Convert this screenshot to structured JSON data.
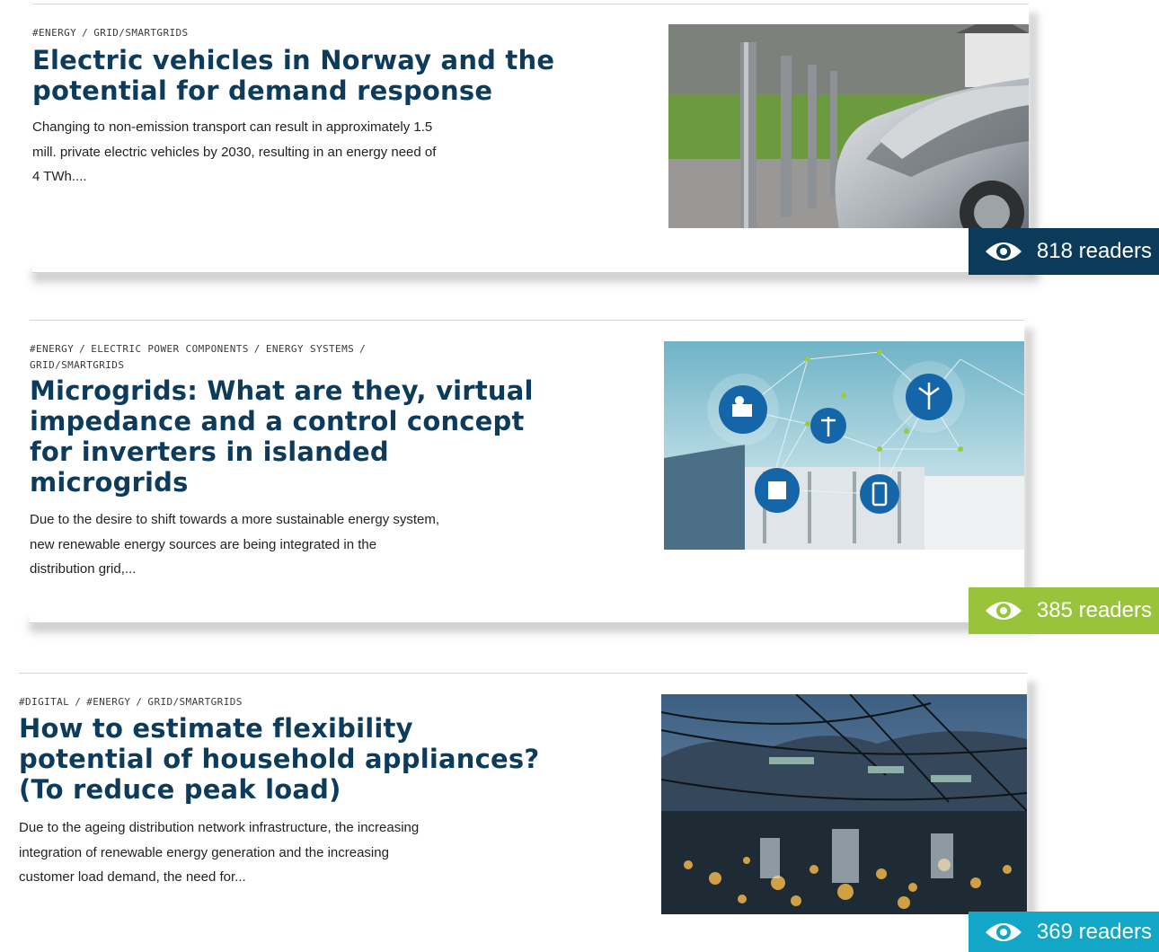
{
  "articles": [
    {
      "tags": [
        "#ENERGY",
        "GRID/SMARTGRIDS"
      ],
      "title_lines": [
        "Electric vehicles in Norway and the",
        "potential for demand response"
      ],
      "excerpt_lines": [
        "Changing to non-emission transport can result in approximately 1.5",
        "mill. private electric vehicles by 2030, resulting in an energy need of",
        "4 TWh...."
      ],
      "image": "ev-charging-station-photo",
      "readers": "818 readers",
      "badge_color": "#0b3a5a"
    },
    {
      "tags": [
        "#ENERGY",
        "ELECTRIC POWER COMPONENTS",
        "ENERGY SYSTEMS"
      ],
      "tags_line2": "GRID/SMARTGRIDS",
      "title_lines": [
        "Microgrids: What are they, virtual",
        "impedance and a control concept",
        "for inverters in islanded",
        "microgrids"
      ],
      "excerpt_lines": [
        "Due to the desire to shift towards a more sustainable energy system,",
        "new renewable energy sources are being integrated in the",
        "distribution grid,..."
      ],
      "image": "microgrid-network-illustration",
      "readers": "385 readers",
      "badge_color": "#9ac33c"
    },
    {
      "tags": [
        "#DIGITAL",
        "#ENERGY",
        "GRID/SMARTGRIDS"
      ],
      "title_lines": [
        "How to estimate flexibility",
        "potential of household appliances?",
        "(To reduce peak load)"
      ],
      "excerpt_lines": [
        "Due to the ageing distribution network infrastructure, the increasing",
        "integration of renewable energy generation and the increasing",
        "customer load demand, the need for..."
      ],
      "image": "power-lines-night-city-photo",
      "readers": "369 readers",
      "badge_color": "#13a7c7"
    }
  ]
}
